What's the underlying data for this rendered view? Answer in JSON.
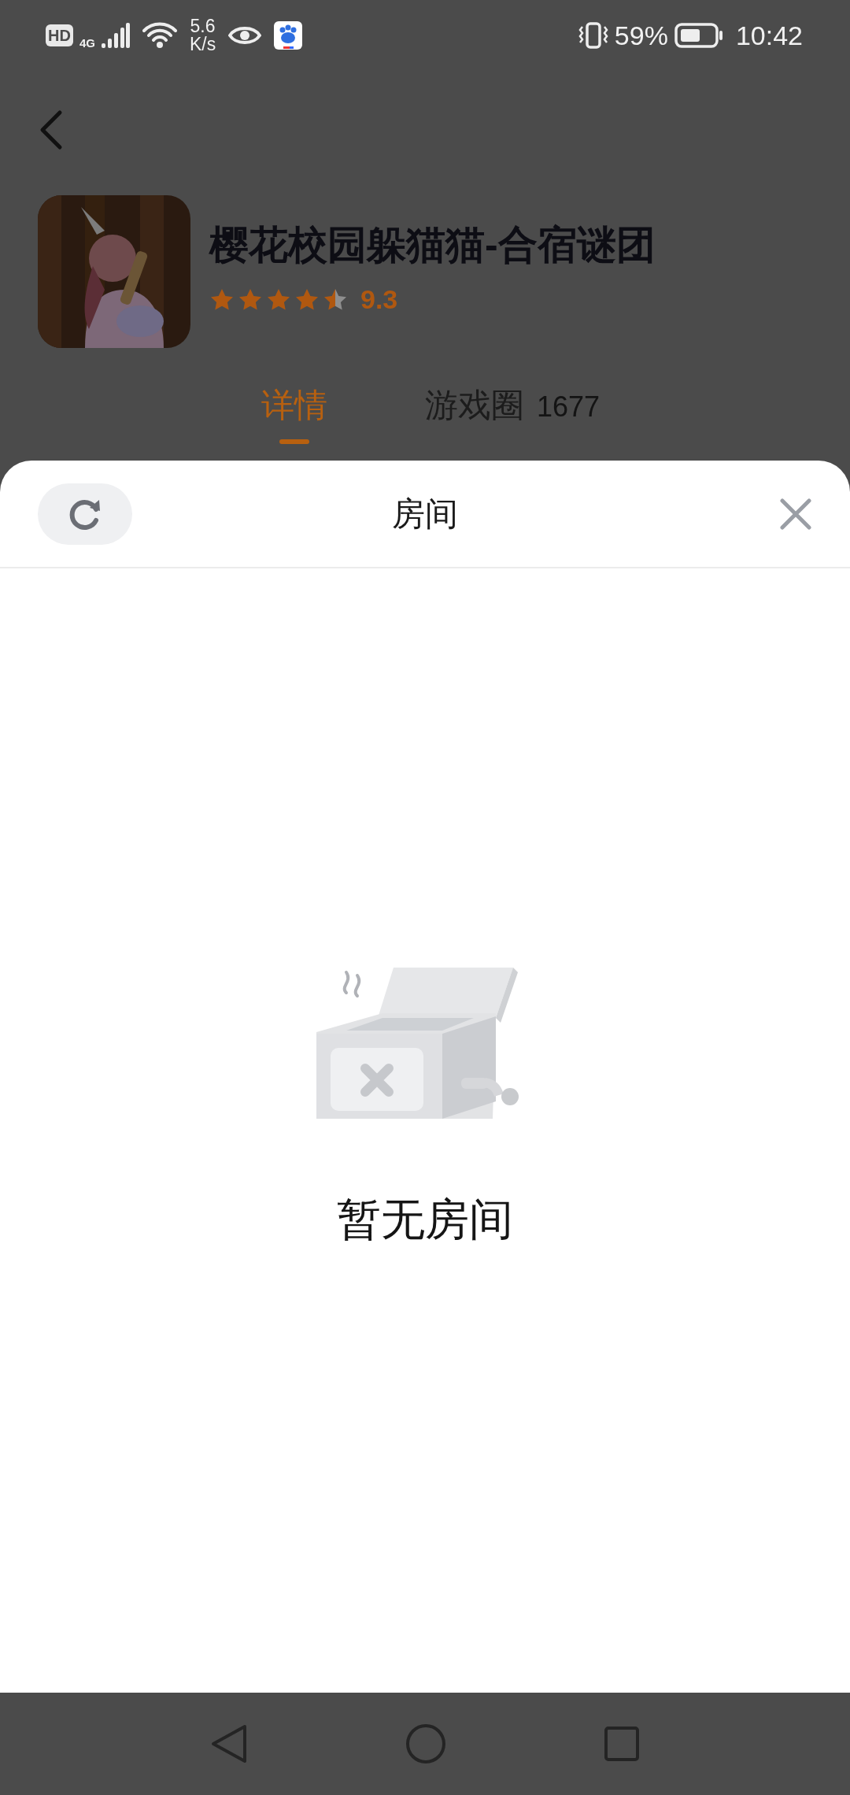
{
  "status_bar": {
    "hd_label": "HD",
    "network_type": "4G",
    "network_speed": "5.6",
    "network_speed_unit": "K/s",
    "battery_percent": "59%",
    "time": "10:42"
  },
  "game": {
    "title": "樱花校园躲猫猫-合宿谜团",
    "stars": 4.5,
    "rating": "9.3"
  },
  "tabs": [
    {
      "label": "详情",
      "selected": true
    },
    {
      "label": "游戏圈",
      "count": "1677",
      "selected": false
    }
  ],
  "sheet": {
    "title": "房间",
    "empty_message": "暂无房间"
  }
}
